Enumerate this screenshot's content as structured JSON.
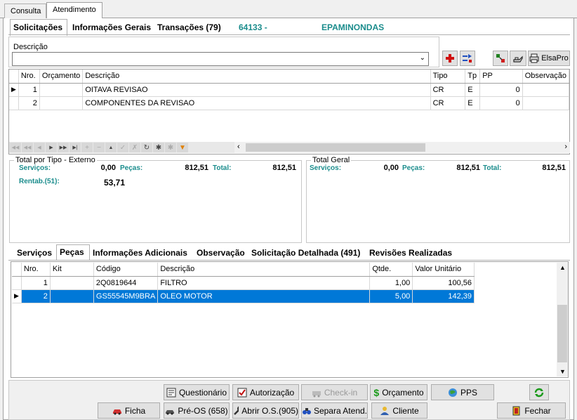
{
  "top_tabs": [
    "Consulta",
    "Atendimento"
  ],
  "sub_tabs": [
    "Solicitações",
    "Informações Gerais",
    "Transações (79)"
  ],
  "header": {
    "code": "64133 -",
    "name": "EPAMINONDAS"
  },
  "description": {
    "label": "Descrição",
    "value": ""
  },
  "toolbar": {
    "elsapro": "ElsaPro"
  },
  "requests_grid": {
    "columns": [
      "Nro.",
      "Orçamento",
      "Descrição",
      "Tipo",
      "Tp",
      "PP",
      "Observação"
    ],
    "rows": [
      {
        "nro": "1",
        "orcamento": "",
        "descricao": "OITAVA REVISAO",
        "tipo": "CR",
        "tp": "E",
        "pp": "0",
        "obs": ""
      },
      {
        "nro": "2",
        "orcamento": "",
        "descricao": "COMPONENTES DA REVISAO",
        "tipo": "CR",
        "tp": "E",
        "pp": "0",
        "obs": ""
      }
    ]
  },
  "total_tipo": {
    "title": "Total por Tipo - Externo",
    "servicos_label": "Serviços:",
    "servicos": "0,00",
    "pecas_label": "Peças:",
    "pecas": "812,51",
    "total_label": "Total:",
    "total": "812,51",
    "rentab_label": "Rentab.(51):",
    "rentab": "53,71"
  },
  "total_geral": {
    "title": "Total Geral",
    "servicos_label": "Serviços:",
    "servicos": "0,00",
    "pecas_label": "Peças:",
    "pecas": "812,51",
    "total_label": "Total:",
    "total": "812,51"
  },
  "bottom_tabs": [
    "Serviços",
    "Peças",
    "Informações Adicionais",
    "Observação",
    "Solicitação Detalhada (491)",
    "Revisões Realizadas"
  ],
  "parts_grid": {
    "columns": [
      "Nro.",
      "Kit",
      "Código",
      "Descrição",
      "Qtde.",
      "Valor Unitário"
    ],
    "rows": [
      {
        "nro": "1",
        "kit": "",
        "codigo": "2Q0819644",
        "descricao": "FILTRO",
        "qtde": "1,00",
        "valor": "100,56"
      },
      {
        "nro": "2",
        "kit": "",
        "codigo": "GS55545M9BRA",
        "descricao": "OLEO MOTOR",
        "qtde": "5,00",
        "valor": "142,39"
      }
    ]
  },
  "buttons": {
    "questionario": "Questionário",
    "autorizacao": "Autorização",
    "checkin": "Check-in",
    "orcamento": "Orçamento",
    "pps": "PPS",
    "ficha": "Ficha",
    "preos": "Pré-OS (658)",
    "abrir": "Abrir O.S.(905)",
    "separa": "Separa Atend.",
    "cliente": "Cliente",
    "fechar": "Fechar"
  },
  "colors": {
    "accent": "#1a8c8c",
    "selection": "#0078d7"
  }
}
